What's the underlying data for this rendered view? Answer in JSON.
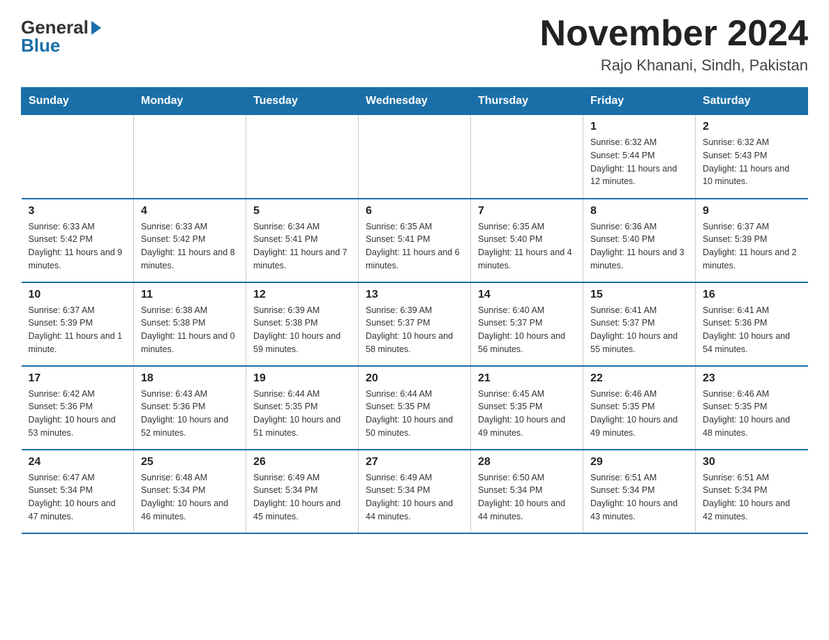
{
  "logo": {
    "general": "General",
    "blue": "Blue"
  },
  "title": "November 2024",
  "location": "Rajo Khanani, Sindh, Pakistan",
  "days_of_week": [
    "Sunday",
    "Monday",
    "Tuesday",
    "Wednesday",
    "Thursday",
    "Friday",
    "Saturday"
  ],
  "weeks": [
    [
      {
        "day": "",
        "info": ""
      },
      {
        "day": "",
        "info": ""
      },
      {
        "day": "",
        "info": ""
      },
      {
        "day": "",
        "info": ""
      },
      {
        "day": "",
        "info": ""
      },
      {
        "day": "1",
        "info": "Sunrise: 6:32 AM\nSunset: 5:44 PM\nDaylight: 11 hours and 12 minutes."
      },
      {
        "day": "2",
        "info": "Sunrise: 6:32 AM\nSunset: 5:43 PM\nDaylight: 11 hours and 10 minutes."
      }
    ],
    [
      {
        "day": "3",
        "info": "Sunrise: 6:33 AM\nSunset: 5:42 PM\nDaylight: 11 hours and 9 minutes."
      },
      {
        "day": "4",
        "info": "Sunrise: 6:33 AM\nSunset: 5:42 PM\nDaylight: 11 hours and 8 minutes."
      },
      {
        "day": "5",
        "info": "Sunrise: 6:34 AM\nSunset: 5:41 PM\nDaylight: 11 hours and 7 minutes."
      },
      {
        "day": "6",
        "info": "Sunrise: 6:35 AM\nSunset: 5:41 PM\nDaylight: 11 hours and 6 minutes."
      },
      {
        "day": "7",
        "info": "Sunrise: 6:35 AM\nSunset: 5:40 PM\nDaylight: 11 hours and 4 minutes."
      },
      {
        "day": "8",
        "info": "Sunrise: 6:36 AM\nSunset: 5:40 PM\nDaylight: 11 hours and 3 minutes."
      },
      {
        "day": "9",
        "info": "Sunrise: 6:37 AM\nSunset: 5:39 PM\nDaylight: 11 hours and 2 minutes."
      }
    ],
    [
      {
        "day": "10",
        "info": "Sunrise: 6:37 AM\nSunset: 5:39 PM\nDaylight: 11 hours and 1 minute."
      },
      {
        "day": "11",
        "info": "Sunrise: 6:38 AM\nSunset: 5:38 PM\nDaylight: 11 hours and 0 minutes."
      },
      {
        "day": "12",
        "info": "Sunrise: 6:39 AM\nSunset: 5:38 PM\nDaylight: 10 hours and 59 minutes."
      },
      {
        "day": "13",
        "info": "Sunrise: 6:39 AM\nSunset: 5:37 PM\nDaylight: 10 hours and 58 minutes."
      },
      {
        "day": "14",
        "info": "Sunrise: 6:40 AM\nSunset: 5:37 PM\nDaylight: 10 hours and 56 minutes."
      },
      {
        "day": "15",
        "info": "Sunrise: 6:41 AM\nSunset: 5:37 PM\nDaylight: 10 hours and 55 minutes."
      },
      {
        "day": "16",
        "info": "Sunrise: 6:41 AM\nSunset: 5:36 PM\nDaylight: 10 hours and 54 minutes."
      }
    ],
    [
      {
        "day": "17",
        "info": "Sunrise: 6:42 AM\nSunset: 5:36 PM\nDaylight: 10 hours and 53 minutes."
      },
      {
        "day": "18",
        "info": "Sunrise: 6:43 AM\nSunset: 5:36 PM\nDaylight: 10 hours and 52 minutes."
      },
      {
        "day": "19",
        "info": "Sunrise: 6:44 AM\nSunset: 5:35 PM\nDaylight: 10 hours and 51 minutes."
      },
      {
        "day": "20",
        "info": "Sunrise: 6:44 AM\nSunset: 5:35 PM\nDaylight: 10 hours and 50 minutes."
      },
      {
        "day": "21",
        "info": "Sunrise: 6:45 AM\nSunset: 5:35 PM\nDaylight: 10 hours and 49 minutes."
      },
      {
        "day": "22",
        "info": "Sunrise: 6:46 AM\nSunset: 5:35 PM\nDaylight: 10 hours and 49 minutes."
      },
      {
        "day": "23",
        "info": "Sunrise: 6:46 AM\nSunset: 5:35 PM\nDaylight: 10 hours and 48 minutes."
      }
    ],
    [
      {
        "day": "24",
        "info": "Sunrise: 6:47 AM\nSunset: 5:34 PM\nDaylight: 10 hours and 47 minutes."
      },
      {
        "day": "25",
        "info": "Sunrise: 6:48 AM\nSunset: 5:34 PM\nDaylight: 10 hours and 46 minutes."
      },
      {
        "day": "26",
        "info": "Sunrise: 6:49 AM\nSunset: 5:34 PM\nDaylight: 10 hours and 45 minutes."
      },
      {
        "day": "27",
        "info": "Sunrise: 6:49 AM\nSunset: 5:34 PM\nDaylight: 10 hours and 44 minutes."
      },
      {
        "day": "28",
        "info": "Sunrise: 6:50 AM\nSunset: 5:34 PM\nDaylight: 10 hours and 44 minutes."
      },
      {
        "day": "29",
        "info": "Sunrise: 6:51 AM\nSunset: 5:34 PM\nDaylight: 10 hours and 43 minutes."
      },
      {
        "day": "30",
        "info": "Sunrise: 6:51 AM\nSunset: 5:34 PM\nDaylight: 10 hours and 42 minutes."
      }
    ]
  ]
}
